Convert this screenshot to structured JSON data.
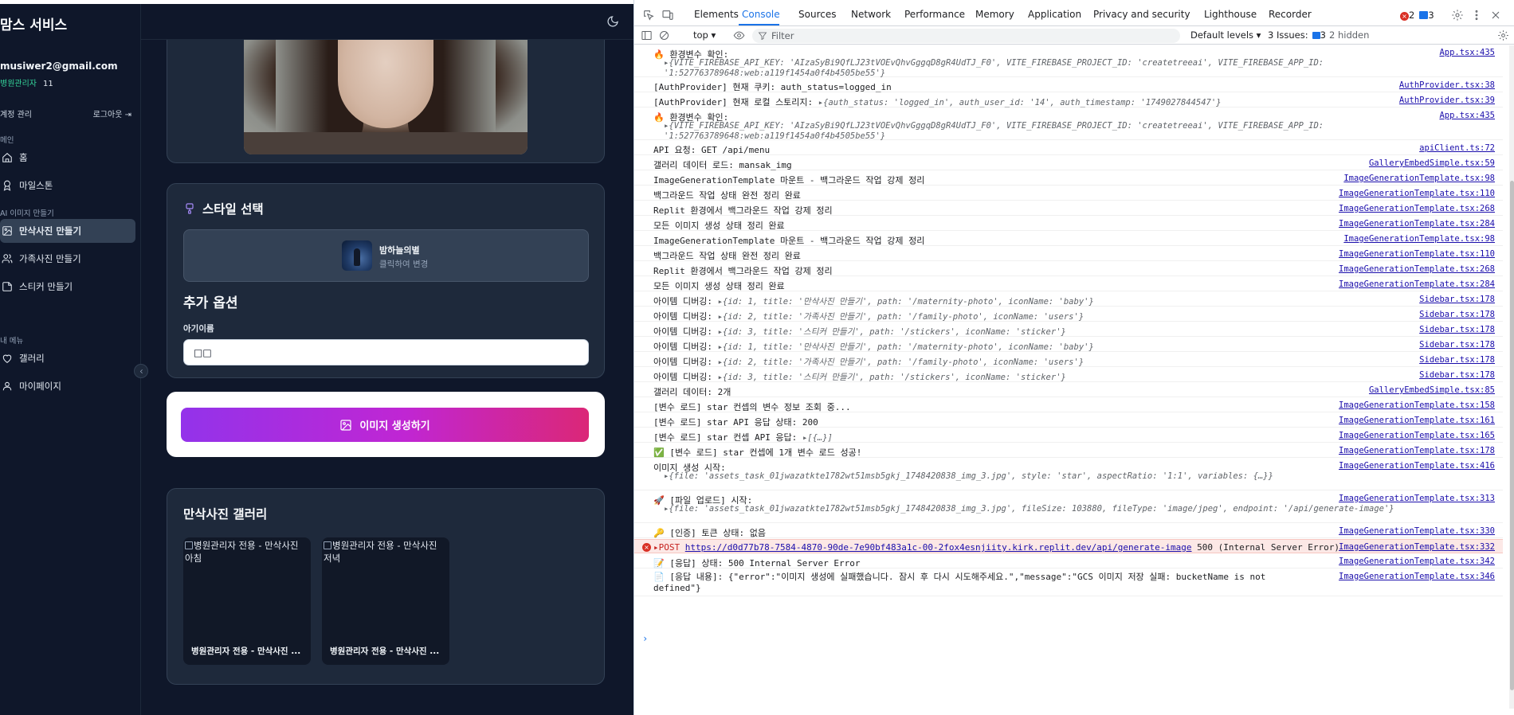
{
  "app": {
    "brand": "맘스 서비스",
    "user": {
      "email": "musiwer2@gmail.com",
      "role": "병원관리자",
      "count": "11"
    },
    "account": {
      "manage": "계정 관리",
      "logout": "로그아웃"
    },
    "sections": {
      "main": "메인",
      "ai": "AI 이미지 만들기",
      "my": "내 메뉴"
    },
    "nav": {
      "home": "홈",
      "milestone": "마일스톤",
      "maternity": "만삭사진 만들기",
      "family": "가족사진 만들기",
      "sticker": "스티커 만들기",
      "gallery": "갤러리",
      "mypage": "마이페이지"
    },
    "style_card": {
      "title": "스타일 선택",
      "style_name": "밤하늘의별",
      "style_hint": "클릭하여 변경",
      "options_title": "추가 옵션",
      "field_label": "아기이름",
      "field_value": "□□"
    },
    "generate_button": "이미지 생성하기",
    "gallery": {
      "title": "만삭사진 갤러리",
      "items": [
        {
          "alt": "병원관리자 전용 - 만삭사진 아침",
          "caption": "병원관리자 전용 - 만삭사진 ..."
        },
        {
          "alt": "병원관리자 전용 - 만삭사진 저녁",
          "caption": "병원관리자 전용 - 만삭사진 ..."
        }
      ]
    }
  },
  "devtools": {
    "tabs": [
      "Elements",
      "Console",
      "Sources",
      "Network",
      "Performance",
      "Memory",
      "Application",
      "Privacy and security",
      "Lighthouse",
      "Recorder"
    ],
    "active_tab": "Console",
    "error_count": "2",
    "message_count": "3",
    "context": "top ▾",
    "filter_placeholder": "Filter",
    "levels": "Default levels ▾",
    "issues": "3 Issues:",
    "issues_count": "3",
    "hidden": "2 hidden",
    "logs": [
      {
        "msg": "🔥 환경변수 확인:",
        "src": "App.tsx:435",
        "obj": "▸{VITE_FIREBASE_API_KEY: 'AIzaSyBi9QfLJ23tVOEvQhvGggqD8gR4UdTJ_F0', VITE_FIREBASE_PROJECT_ID: 'createtreeai', VITE_FIREBASE_APP_ID: '1:527763789648:web:a119f1454a0f4b4505be55'}"
      },
      {
        "msg": "[AuthProvider] 현재 쿠키: auth_status=logged_in",
        "src": "AuthProvider.tsx:38"
      },
      {
        "msg": "[AuthProvider] 현재 로컬 스토리지:",
        "inline": "▸{auth_status: 'logged_in', auth_user_id: '14', auth_timestamp: '1749027844547'}",
        "src": "AuthProvider.tsx:39"
      },
      {
        "msg": "🔥 환경변수 확인:",
        "src": "App.tsx:435",
        "obj": "▸{VITE_FIREBASE_API_KEY: 'AIzaSyBi9QfLJ23tVOEvQhvGggqD8gR4UdTJ_F0', VITE_FIREBASE_PROJECT_ID: 'createtreeai', VITE_FIREBASE_APP_ID: '1:527763789648:web:a119f1454a0f4b4505be55'}"
      },
      {
        "msg": "API 요청: GET /api/menu",
        "src": "apiClient.ts:72"
      },
      {
        "msg": "갤러리 데이터 로드: mansak_img",
        "src": "GalleryEmbedSimple.tsx:59"
      },
      {
        "msg": "ImageGenerationTemplate 마운트 - 백그라운드 작업 강제 정리",
        "src": "ImageGenerationTemplate.tsx:98"
      },
      {
        "msg": "백그라운드 작업 상태 완전 정리 완료",
        "src": "ImageGenerationTemplate.tsx:110"
      },
      {
        "msg": "Replit 환경에서 백그라운드 작업 강제 정리",
        "src": "ImageGenerationTemplate.tsx:268"
      },
      {
        "msg": "모든 이미지 생성 상태 정리 완료",
        "src": "ImageGenerationTemplate.tsx:284"
      },
      {
        "msg": "ImageGenerationTemplate 마운트 - 백그라운드 작업 강제 정리",
        "src": "ImageGenerationTemplate.tsx:98"
      },
      {
        "msg": "백그라운드 작업 상태 완전 정리 완료",
        "src": "ImageGenerationTemplate.tsx:110"
      },
      {
        "msg": "Replit 환경에서 백그라운드 작업 강제 정리",
        "src": "ImageGenerationTemplate.tsx:268"
      },
      {
        "msg": "모든 이미지 생성 상태 정리 완료",
        "src": "ImageGenerationTemplate.tsx:284"
      },
      {
        "msg": "아이템 디버깅:",
        "inline": "▸{id: 1, title: '만삭사진 만들기', path: '/maternity-photo', iconName: 'baby'}",
        "src": "Sidebar.tsx:178"
      },
      {
        "msg": "아이템 디버깅:",
        "inline": "▸{id: 2, title: '가족사진 만들기', path: '/family-photo', iconName: 'users'}",
        "src": "Sidebar.tsx:178"
      },
      {
        "msg": "아이템 디버깅:",
        "inline": "▸{id: 3, title: '스티커 만들기', path: '/stickers', iconName: 'sticker'}",
        "src": "Sidebar.tsx:178"
      },
      {
        "msg": "아이템 디버깅:",
        "inline": "▸{id: 1, title: '만삭사진 만들기', path: '/maternity-photo', iconName: 'baby'}",
        "src": "Sidebar.tsx:178"
      },
      {
        "msg": "아이템 디버깅:",
        "inline": "▸{id: 2, title: '가족사진 만들기', path: '/family-photo', iconName: 'users'}",
        "src": "Sidebar.tsx:178"
      },
      {
        "msg": "아이템 디버깅:",
        "inline": "▸{id: 3, title: '스티커 만들기', path: '/stickers', iconName: 'sticker'}",
        "src": "Sidebar.tsx:178"
      },
      {
        "msg": "갤러리 데이터: 2개",
        "src": "GalleryEmbedSimple.tsx:85"
      },
      {
        "msg": "[변수 로드] star 컨셉의 변수 정보 조회 중...",
        "src": "ImageGenerationTemplate.tsx:158"
      },
      {
        "msg": "[변수 로드] star API 응답 상태: 200",
        "src": "ImageGenerationTemplate.tsx:161"
      },
      {
        "msg": "[변수 로드] star 컨셉 API 응답:",
        "inline": "▸[{…}]",
        "src": "ImageGenerationTemplate.tsx:165"
      },
      {
        "msg": "✅ [변수 로드] star 컨셉에 1개 변수 로드 성공!",
        "src": "ImageGenerationTemplate.tsx:178"
      },
      {
        "msg": "이미지 생성 시작:",
        "src": "ImageGenerationTemplate.tsx:416",
        "obj": "▸{file: 'assets_task_01jwazatkte1782wt51msb5gkj_1748420838_img_3.jpg', style: 'star', aspectRatio: '1:1', variables: {…}}"
      },
      {
        "msg": "🚀 [파일 업로드] 시작:",
        "src": "ImageGenerationTemplate.tsx:313",
        "obj": "▸{file: 'assets_task_01jwazatkte1782wt51msb5gkj_1748420838_img_3.jpg', fileSize: 103880, fileType: 'image/jpeg', endpoint: '/api/generate-image'}"
      },
      {
        "msg": "🔑 [인증] 토큰 상태: 없음",
        "src": "ImageGenerationTemplate.tsx:330"
      },
      {
        "error": true,
        "method": "▸POST",
        "url": "https://d0d77b78-7584-4870-90de-7e90bf483a1c-00-2fox4esnjiity.kirk.replit.dev/api/generate-image",
        "status": "500 (Internal Server Error)",
        "src": "ImageGenerationTemplate.tsx:332"
      },
      {
        "msg": "📝 [응답] 상태: 500 Internal Server Error",
        "src": "ImageGenerationTemplate.tsx:342"
      },
      {
        "msg": "📄 [응답 내용]: {\"error\":\"이미지 생성에 실패했습니다. 잠시 후 다시 시도해주세요.\",\"message\":\"GCS 이미지 저장 실패: bucketName is not",
        "msg2": "defined\"}",
        "src": "ImageGenerationTemplate.tsx:346"
      }
    ],
    "prompt": "›"
  }
}
